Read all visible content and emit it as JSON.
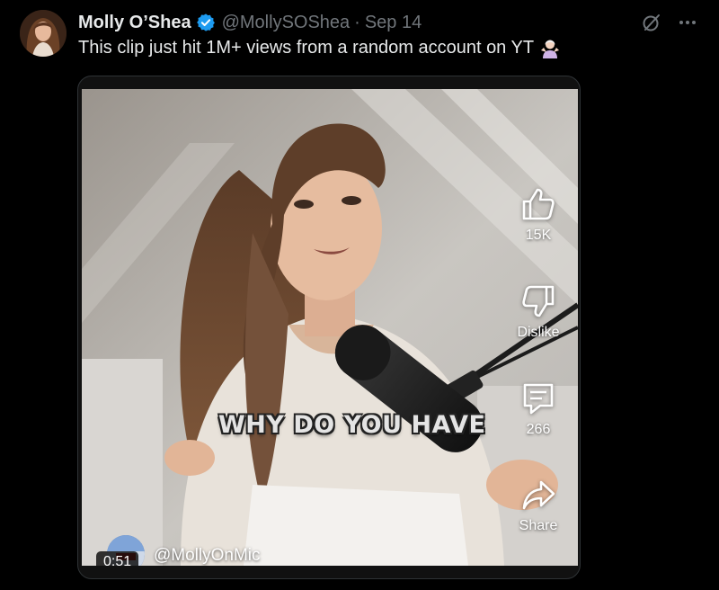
{
  "tweet": {
    "author_name": "Molly O’Shea",
    "handle": "@MollySOShea",
    "separator": "·",
    "date": "Sep 14",
    "text": "This clip just hit 1M+ views from a random account on YT"
  },
  "video": {
    "caption": "WHY DO YOU HAVE",
    "channel": "@MollyOnMic",
    "duration": "0:51",
    "actions": {
      "like_count": "15K",
      "dislike_label": "Dislike",
      "comment_count": "266",
      "share_label": "Share"
    }
  },
  "colors": {
    "background": "#000000",
    "text_primary": "#e7e9ea",
    "text_secondary": "#71767b",
    "verified_badge": "#1d9bf0"
  },
  "icons": {
    "verified": "verified-badge-icon",
    "grok": "grok-icon",
    "more": "more-icon",
    "emoji": "woman-shrugging-emoji",
    "like": "thumbs-up-icon",
    "dislike": "thumbs-down-icon",
    "comment": "comment-icon",
    "share": "share-icon"
  }
}
